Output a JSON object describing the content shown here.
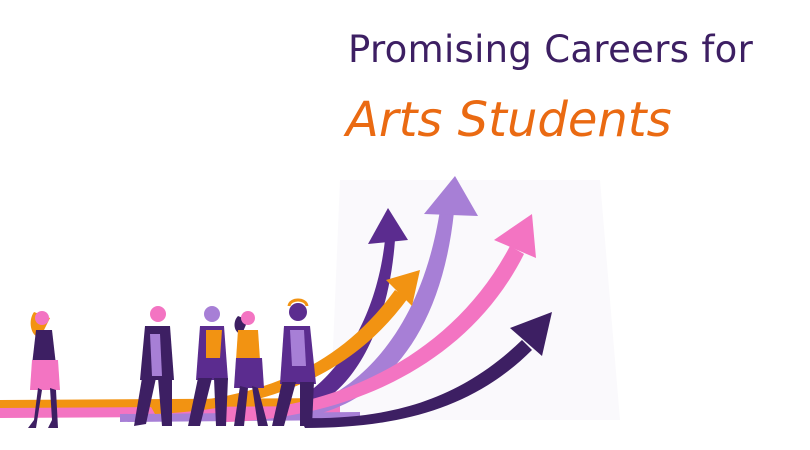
{
  "banner": {
    "title_line1": "Promising Careers for",
    "title_line2": "Arts Students"
  },
  "colors": {
    "dark_purple": "#3d1f63",
    "purple": "#5b2c8f",
    "lavender": "#a77fd6",
    "orange": "#f29312",
    "pink": "#f374c2",
    "accent_text": "#ea6a12"
  },
  "illustration": {
    "arrows": [
      "dark-purple-arrow",
      "orange-arrow",
      "lavender-arrow",
      "pink-arrow",
      "navy-arrow"
    ],
    "people_count": 5
  }
}
